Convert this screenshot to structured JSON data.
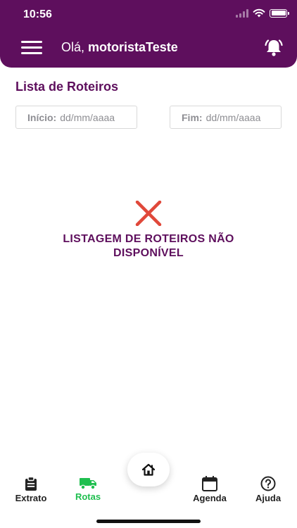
{
  "status_bar": {
    "time": "10:56"
  },
  "header": {
    "greeting_prefix": "Olá,",
    "username": "motoristaTeste"
  },
  "section": {
    "title": "Lista de Roteiros"
  },
  "filters": {
    "start_label": "Início:",
    "start_placeholder": "dd/mm/aaaa",
    "end_label": "Fim:",
    "end_placeholder": "dd/mm/aaaa"
  },
  "empty_state": {
    "message": "LISTAGEM DE ROTEIROS NÃO DISPONÍVEL",
    "icon": "close-icon"
  },
  "tabbar": {
    "active": "Rotas",
    "items": [
      {
        "label": "Extrato",
        "icon": "clipboard-icon"
      },
      {
        "label": "Rotas",
        "icon": "truck-icon"
      },
      {
        "label": "Agenda",
        "icon": "calendar-icon"
      },
      {
        "label": "Ajuda",
        "icon": "help-icon"
      }
    ],
    "home_icon": "home-icon"
  },
  "colors": {
    "brand": "#5e0f5d",
    "active_tab": "#1fbf4f",
    "error": "#e0483a"
  }
}
